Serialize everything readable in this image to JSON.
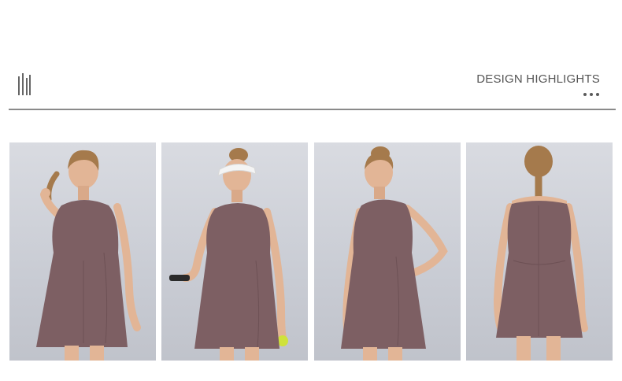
{
  "header": {
    "logo_icon": "brand-monogram-icon",
    "section_title": "DESIGN HIGHLIGHTS",
    "dots_icon": "ellipsis-icon"
  },
  "gallery": {
    "photos": [
      {
        "pose": "front-braid-hold",
        "dress_color": "#7d5f63"
      },
      {
        "pose": "front-visor-racket",
        "dress_color": "#7d5f63"
      },
      {
        "pose": "three-quarter-pocket",
        "dress_color": "#7d5f63"
      },
      {
        "pose": "back-view",
        "dress_color": "#7d5f63"
      }
    ]
  },
  "colors": {
    "background": "#ffffff",
    "title": "#555555",
    "divider": "#8a8a8a",
    "photo_bg": "#d3d5dc",
    "dress": "#7d5f63",
    "skin": "#e2b596",
    "hair": "#a57a4c"
  }
}
